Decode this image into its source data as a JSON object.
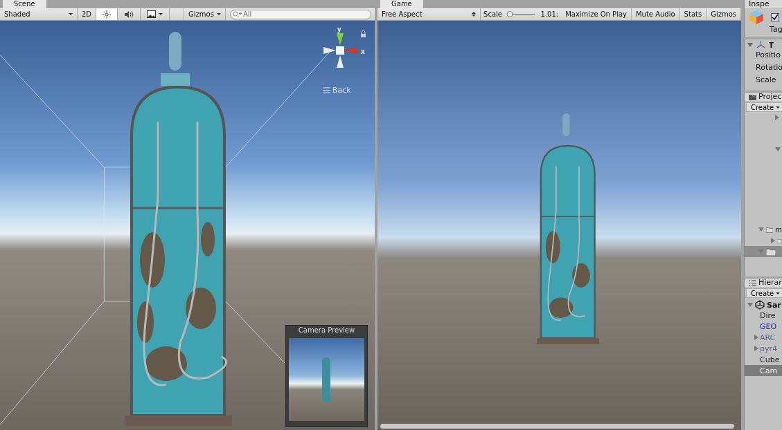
{
  "scene": {
    "tab": "Scene",
    "toolbar": {
      "draw_mode": "Shaded",
      "mode_2d": "2D",
      "lighting_on": true,
      "audio_on": false,
      "gizmos": "Gizmos",
      "search": {
        "placeholder": "All"
      }
    },
    "gizmo": {
      "y_label": "y",
      "x_label": "x",
      "view_label": "Back"
    },
    "camera_preview": {
      "title": "Camera Preview"
    }
  },
  "game": {
    "tab": "Game",
    "toolbar": {
      "aspect": "Free Aspect",
      "scale_label": "Scale",
      "scale": {
        "level": 0.06
      },
      "scale_value": "1.01:",
      "buttons": [
        {
          "label": "Maximize On Play",
          "on": false
        },
        {
          "label": "Mute Audio",
          "on": false
        },
        {
          "label": "Stats",
          "on": false
        },
        {
          "label": "Gizmos",
          "on": false
        }
      ]
    }
  },
  "inspector": {
    "tab": "Inspe",
    "active": true,
    "tag_label": "Tag",
    "component": "T",
    "fields": [
      "Positio",
      "Rotatio",
      "Scale"
    ]
  },
  "project": {
    "tab": "Projec",
    "create": "Create",
    "rows": [
      {
        "kind": "arrow",
        "expanded": false,
        "selected": false
      },
      {
        "kind": "arrow",
        "expanded": true,
        "selected": false
      },
      {
        "kind": "folder",
        "label": "m",
        "expanded": true,
        "selected": false
      },
      {
        "kind": "folder",
        "expanded": false,
        "selected": false
      },
      {
        "kind": "folder",
        "expanded": true,
        "selected": true
      }
    ]
  },
  "hierarchy": {
    "tab": "Hierar",
    "create": "Create",
    "scene": "Sar",
    "items": [
      {
        "label": "Dire",
        "kind": "object",
        "expandable": false,
        "selected": false
      },
      {
        "label": "GEO",
        "kind": "prefab",
        "expandable": false,
        "selected": false
      },
      {
        "label": "ARC",
        "kind": "model",
        "expandable": true,
        "selected": false
      },
      {
        "label": "pyr4",
        "kind": "model",
        "expandable": true,
        "selected": false
      },
      {
        "label": "Cube",
        "kind": "object",
        "expandable": false,
        "selected": false
      },
      {
        "label": "Cam",
        "kind": "object",
        "expandable": false,
        "selected": true
      }
    ]
  }
}
